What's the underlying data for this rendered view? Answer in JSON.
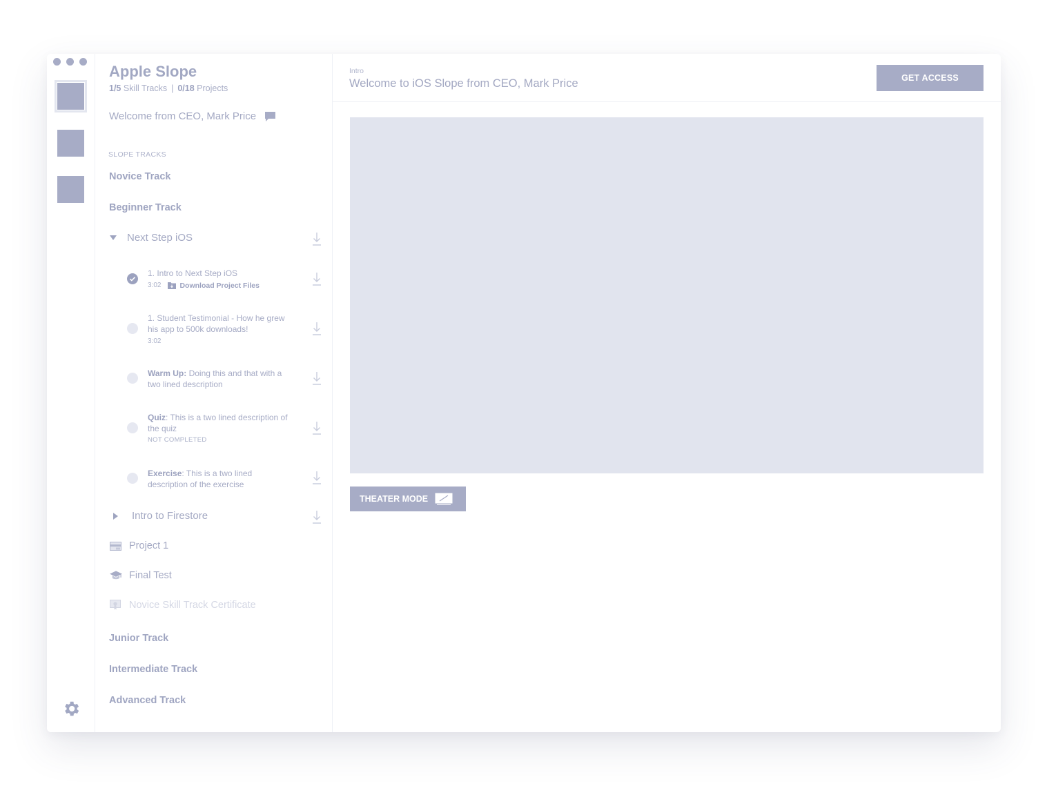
{
  "app": {
    "title": "Apple Slope",
    "stats": {
      "tracks_count": "1/5",
      "tracks_label": "Skill Tracks",
      "separator": "|",
      "projects_count": "0/18",
      "projects_label": "Projects"
    },
    "welcome_link": "Welcome from CEO, Mark Price"
  },
  "sidebar": {
    "section_label": "SLOPE TRACKS",
    "tracks": {
      "novice": "Novice Track",
      "beginner": "Beginner Track",
      "junior": "Junior Track",
      "intermediate": "Intermediate Track",
      "advanced": "Advanced Track"
    },
    "expanded_course": "Next Step iOS",
    "lessons": [
      {
        "title": "1. Intro to Next Step iOS",
        "duration": "3:02",
        "files_label": "Download Project Files",
        "completed": true
      },
      {
        "title": "1. Student Testimonial - How he grew his app to 500k downloads!",
        "duration": "3:02"
      },
      {
        "bold": "Warm Up:",
        "rest": " Doing this and that with a two lined description"
      },
      {
        "bold": "Quiz",
        "rest": ": This is a two lined description of the quiz",
        "status": "NOT COMPLETED"
      },
      {
        "bold": "Exercise",
        "rest": ": This is a two lined description of the exercise"
      }
    ],
    "collapsed_course": "Intro to Firestore",
    "project": "Project 1",
    "final_test": "Final Test",
    "certificate": "Novice Skill Track Certificate"
  },
  "main": {
    "breadcrumb": "Intro",
    "title": "Welcome to iOS Slope from CEO, Mark Price",
    "get_access": "GET ACCESS",
    "theater_mode": "THEATER MODE"
  },
  "colors": {
    "accent": "#a7acc6",
    "video_placeholder": "#e1e4ee",
    "divider": "#eef0f5"
  },
  "icons": {
    "rail": [
      "dashboard-tile-icon",
      "library-tile-icon",
      "profile-tile-icon",
      "gear-icon"
    ],
    "sidebar": [
      "chat-bubble-icon",
      "download-icon",
      "check-icon",
      "folder-icon",
      "project-card-icon",
      "graduation-cap-icon",
      "certificate-icon"
    ],
    "main": [
      "theater-screen-icon"
    ]
  }
}
